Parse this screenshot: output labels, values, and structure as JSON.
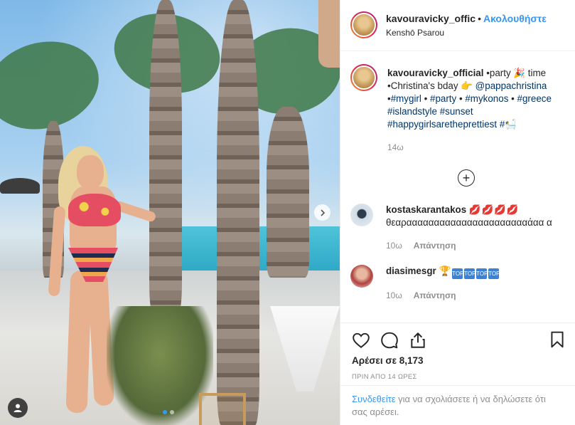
{
  "header": {
    "username": "kavouravicky_offic",
    "separator": "•",
    "follow_label": "Ακολουθήστε",
    "location": "Kenshō Psarou"
  },
  "caption": {
    "username": "kavouravicky_official",
    "text_1": " •party 🎉 time •Christina's bday 👉 ",
    "mention": "@pappachristina",
    "text_2": " •",
    "tag_1": "#mygirl",
    "sep_1": " • ",
    "tag_2": "#party",
    "sep_2": " • ",
    "tag_3": "#mykonos",
    "sep_3": " • ",
    "tag_4": "#greece",
    "tag_5": "#islandstyle",
    "tag_6": "#sunset",
    "tag_7": "#happygirlsaretheprettiest",
    "tag_8": "#🛀",
    "time": "14ω"
  },
  "comments": [
    {
      "username": "kostaskarantakos",
      "emoji": "💋💋💋💋",
      "text": "θεαρααααααααααααααααααααααάαα α",
      "time": "10ω",
      "reply_label": "Απάντηση"
    },
    {
      "username": "diasimesgr",
      "emoji": "🏆",
      "top_badges": [
        "TOP",
        "TOP",
        "TOP",
        "TOP"
      ],
      "time": "10ω",
      "reply_label": "Απάντηση"
    }
  ],
  "actions": {
    "likes": "Αρέσει σε 8,173",
    "timestamp": "ΠΡΙΝ ΑΠΟ 14 ΩΡΕΣ"
  },
  "login_prompt": {
    "link": "Συνδεθείτε",
    "text": " για να σχολιάσετε ή να δηλώσετε ότι σας αρέσει."
  },
  "carousel": {
    "dots": 2,
    "active_index": 0
  },
  "colors": {
    "accent": "#3897f0",
    "hashtag": "#003569",
    "muted": "#8e8e8e",
    "text": "#262626"
  }
}
